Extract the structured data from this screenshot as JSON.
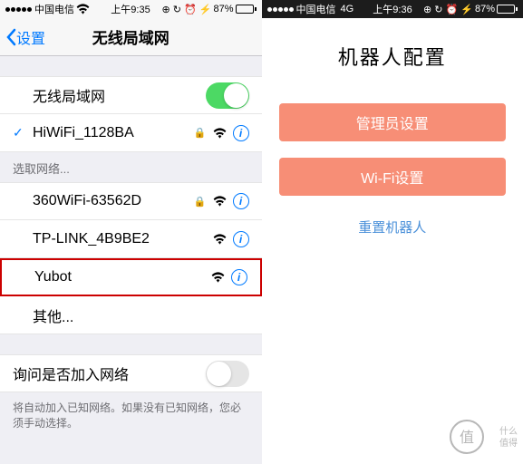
{
  "left": {
    "status": {
      "carrier": "中国电信",
      "time": "上午9:35",
      "battery": "87%"
    },
    "nav": {
      "back": "设置",
      "title": "无线局域网"
    },
    "wifi_toggle_label": "无线局域网",
    "connected": {
      "name": "HiWiFi_1128BA"
    },
    "choose_label": "选取网络...",
    "networks": [
      {
        "name": "360WiFi-63562D",
        "locked": true
      },
      {
        "name": "TP-LINK_4B9BE2",
        "locked": false
      },
      {
        "name": "Yubot",
        "locked": false
      }
    ],
    "other": "其他...",
    "ask_label": "询问是否加入网络",
    "ask_note": "将自动加入已知网络。如果没有已知网络，您必须手动选择。"
  },
  "right": {
    "status": {
      "carrier": "中国电信",
      "net": "4G",
      "time": "上午9:36",
      "battery": "87%"
    },
    "title": "机器人配置",
    "btn_admin": "管理员设置",
    "btn_wifi": "Wi-Fi设置",
    "reset": "重置机器人"
  },
  "watermark": "值 什么值得买"
}
